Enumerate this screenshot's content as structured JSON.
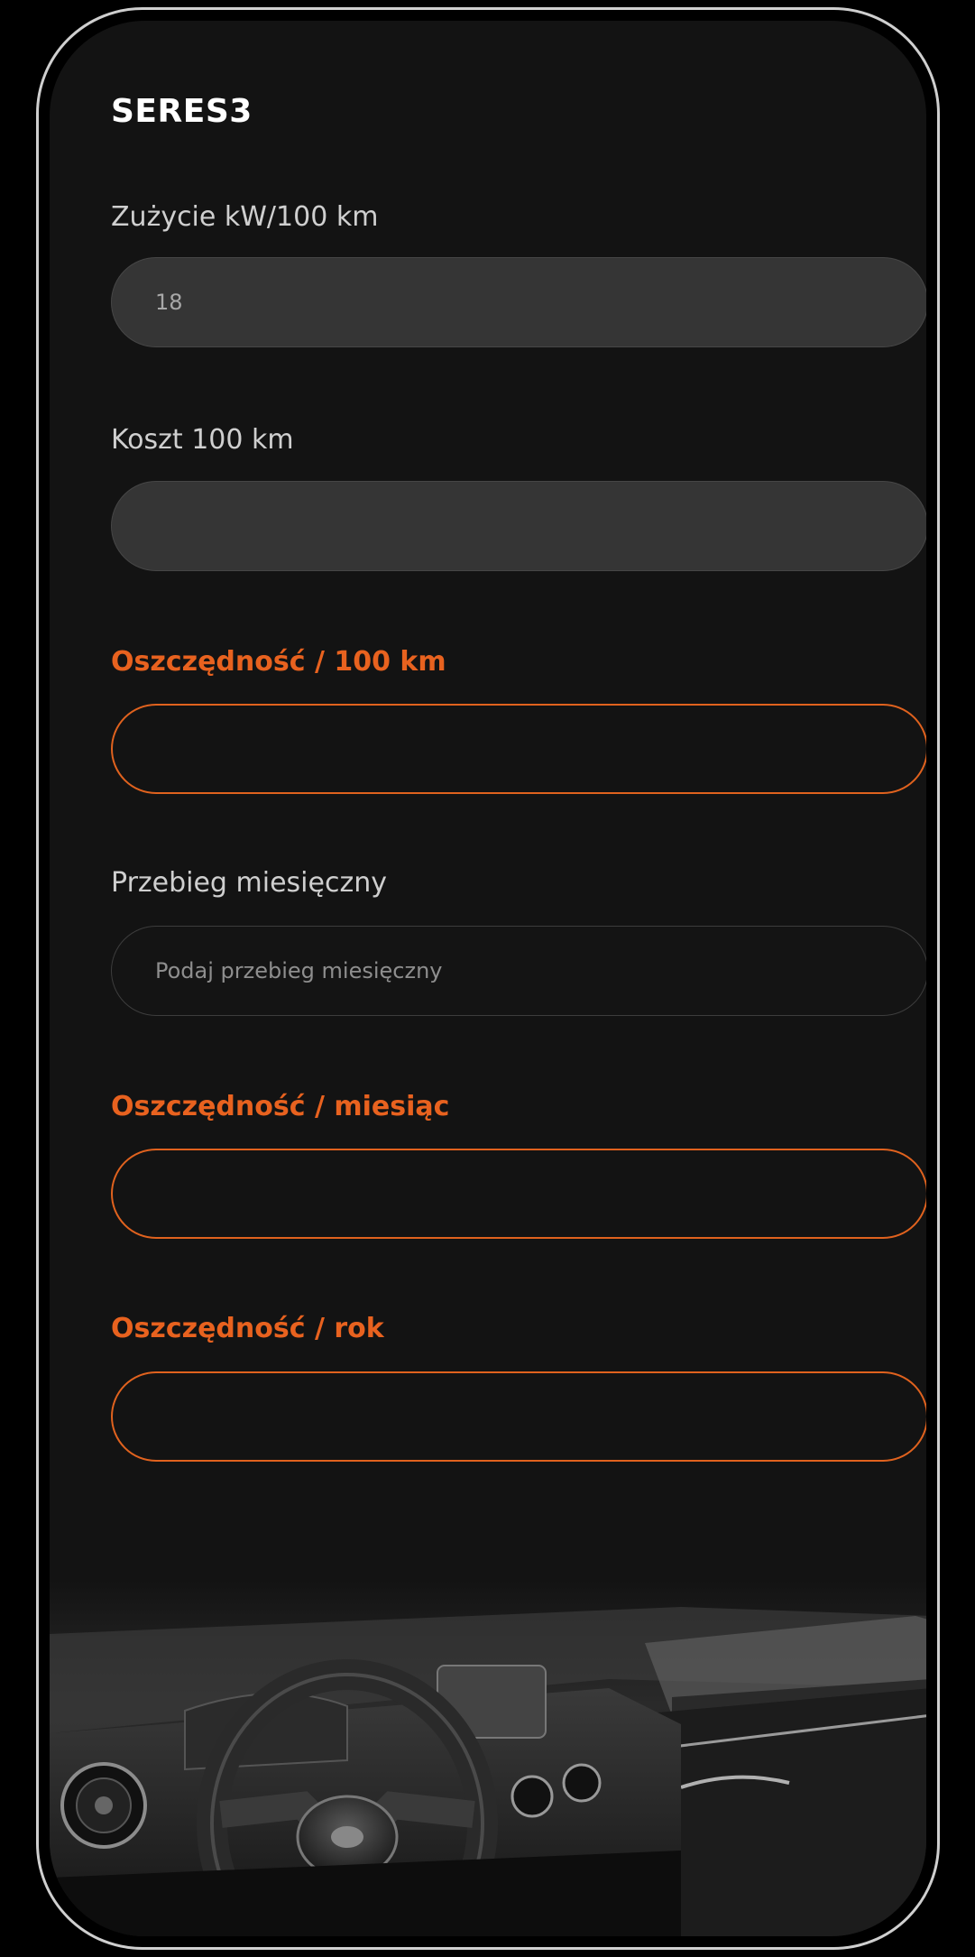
{
  "app": {
    "title": "SERES3"
  },
  "form": {
    "consumption": {
      "label": "Zużycie kW/100 km",
      "value": "18"
    },
    "cost_per_100": {
      "label": "Koszt 100 km",
      "value": ""
    },
    "saving_per_100": {
      "label": "Oszczędność / 100 km",
      "value": ""
    },
    "monthly_mileage": {
      "label": "Przebieg miesięczny",
      "value": "",
      "placeholder": "Podaj przebieg miesięczny"
    },
    "saving_per_month": {
      "label": "Oszczędność / miesiąc",
      "value": ""
    },
    "saving_per_year": {
      "label": "Oszczędność / rok",
      "value": ""
    }
  },
  "colors": {
    "accent": "#e8621f",
    "background": "#131313",
    "field_filled": "#353535",
    "text_primary": "#ffffff",
    "text_secondary": "#cfcfcf"
  },
  "images": {
    "car_interior": "car-interior-photo"
  }
}
